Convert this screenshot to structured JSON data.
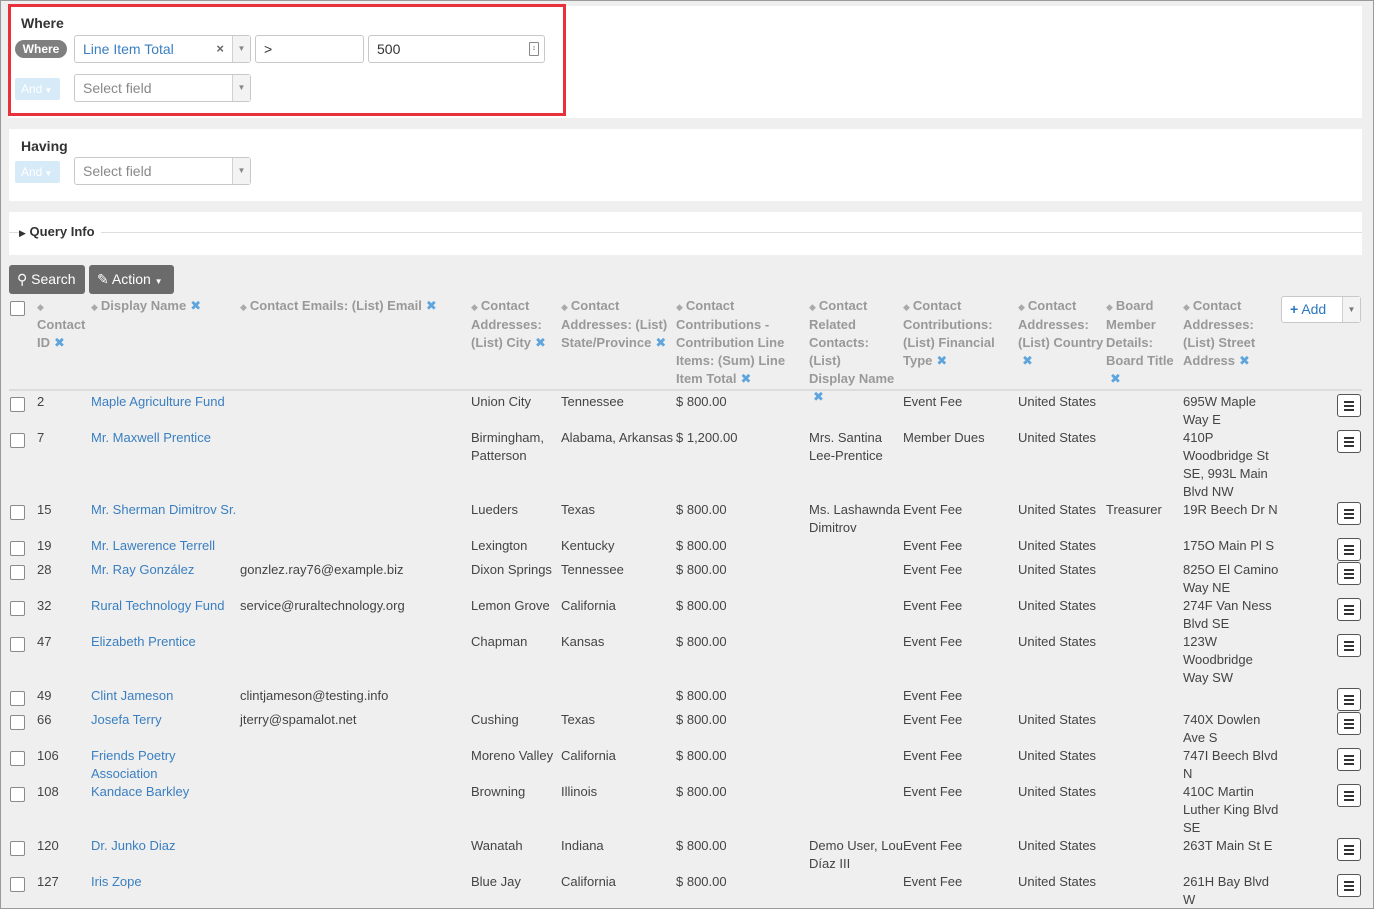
{
  "where": {
    "title": "Where",
    "pill": "Where",
    "field": "Line Item Total",
    "clear": "×",
    "operator": ">",
    "value": "500",
    "and_label": "And",
    "select_placeholder": "Select field"
  },
  "having": {
    "title": "Having",
    "and_label": "And",
    "select_placeholder": "Select field"
  },
  "query_info": {
    "label": "Query Info"
  },
  "toolbar": {
    "search_label": "Search",
    "action_label": "Action",
    "add_label": "Add"
  },
  "columns": [
    {
      "lines": [
        "",
        "Contact",
        "ID"
      ]
    },
    {
      "lines": [
        "Display Name"
      ]
    },
    {
      "lines": [
        "Contact Emails: (List) Email"
      ]
    },
    {
      "lines": [
        "Contact",
        "Addresses:",
        "(List) City"
      ]
    },
    {
      "lines": [
        "Contact",
        "Addresses: (List)",
        "State/Province"
      ]
    },
    {
      "lines": [
        "Contact",
        "Contributions -",
        "Contribution Line",
        "Items: (Sum) Line",
        "Item Total"
      ]
    },
    {
      "lines": [
        "Contact",
        "Related",
        "Contacts: (List)",
        "Display Name",
        ""
      ]
    },
    {
      "lines": [
        "Contact",
        "Contributions:",
        "(List) Financial",
        "Type"
      ]
    },
    {
      "lines": [
        "Contact",
        "Addresses:",
        "(List) Country",
        ""
      ]
    },
    {
      "lines": [
        "Board",
        "Member",
        "Details:",
        "Board Title",
        ""
      ]
    },
    {
      "lines": [
        "Contact",
        "Addresses:",
        "(List) Street",
        "Address"
      ]
    }
  ],
  "rows": [
    {
      "id": "2",
      "name": [
        "Maple Agriculture Fund"
      ],
      "email": "",
      "city": [
        "Union City"
      ],
      "state": [
        "Tennessee"
      ],
      "total": "$ 800.00",
      "related": [],
      "type": "Event Fee",
      "country": "United States",
      "board": "",
      "street": [
        "695W Maple",
        "Way E"
      ]
    },
    {
      "id": "7",
      "name": [
        "Mr. Maxwell Prentice"
      ],
      "email": "",
      "city": [
        "Birmingham,",
        "Patterson"
      ],
      "state": [
        "Alabama, Arkansas"
      ],
      "total": "$ 1,200.00",
      "related": [
        "Mrs. Santina",
        "Lee-Prentice"
      ],
      "type": "Member Dues",
      "country": "United States",
      "board": "",
      "street": [
        "410P",
        "Woodbridge St",
        "SE, 993L Main",
        "Blvd NW"
      ]
    },
    {
      "id": "15",
      "name": [
        "Mr. Sherman Dimitrov Sr."
      ],
      "email": "",
      "city": [
        "Lueders"
      ],
      "state": [
        "Texas"
      ],
      "total": "$ 800.00",
      "related": [
        "Ms. Lashawnda",
        "Dimitrov"
      ],
      "type": "Event Fee",
      "country": "United States",
      "board": "Treasurer",
      "street": [
        "19R Beech Dr N"
      ]
    },
    {
      "id": "19",
      "name": [
        "Mr. Lawerence Terrell"
      ],
      "email": "",
      "city": [
        "Lexington"
      ],
      "state": [
        "Kentucky"
      ],
      "total": "$ 800.00",
      "related": [],
      "type": "Event Fee",
      "country": "United States",
      "board": "",
      "street": [
        "175O Main Pl S"
      ]
    },
    {
      "id": "28",
      "name": [
        "Mr. Ray González"
      ],
      "email": "gonzlez.ray76@example.biz",
      "city": [
        "Dixon Springs"
      ],
      "state": [
        "Tennessee"
      ],
      "total": "$ 800.00",
      "related": [],
      "type": "Event Fee",
      "country": "United States",
      "board": "",
      "street": [
        "825O El Camino",
        "Way NE"
      ]
    },
    {
      "id": "32",
      "name": [
        "Rural Technology Fund"
      ],
      "email": "service@ruraltechnology.org",
      "city": [
        "Lemon Grove"
      ],
      "state": [
        "California"
      ],
      "total": "$ 800.00",
      "related": [],
      "type": "Event Fee",
      "country": "United States",
      "board": "",
      "street": [
        "274F Van Ness",
        "Blvd SE"
      ]
    },
    {
      "id": "47",
      "name": [
        "Elizabeth Prentice"
      ],
      "email": "",
      "city": [
        "Chapman"
      ],
      "state": [
        "Kansas"
      ],
      "total": "$ 800.00",
      "related": [],
      "type": "Event Fee",
      "country": "United States",
      "board": "",
      "street": [
        "123W",
        "Woodbridge",
        "Way SW"
      ]
    },
    {
      "id": "49",
      "name": [
        "Clint Jameson"
      ],
      "email": "clintjameson@testing.info",
      "city": [],
      "state": [],
      "total": "$ 800.00",
      "related": [],
      "type": "Event Fee",
      "country": "",
      "board": "",
      "street": []
    },
    {
      "id": "66",
      "name": [
        "Josefa Terry"
      ],
      "email": "jterry@spamalot.net",
      "city": [
        "Cushing"
      ],
      "state": [
        "Texas"
      ],
      "total": "$ 800.00",
      "related": [],
      "type": "Event Fee",
      "country": "United States",
      "board": "",
      "street": [
        "740X Dowlen",
        "Ave S"
      ]
    },
    {
      "id": "106",
      "name": [
        "Friends Poetry",
        "Association"
      ],
      "email": "",
      "city": [
        "Moreno Valley"
      ],
      "state": [
        "California"
      ],
      "total": "$ 800.00",
      "related": [],
      "type": "Event Fee",
      "country": "United States",
      "board": "",
      "street": [
        "747I Beech Blvd",
        "N"
      ]
    },
    {
      "id": "108",
      "name": [
        "Kandace Barkley"
      ],
      "email": "",
      "city": [
        "Browning"
      ],
      "state": [
        "Illinois"
      ],
      "total": "$ 800.00",
      "related": [],
      "type": "Event Fee",
      "country": "United States",
      "board": "",
      "street": [
        "410C Martin",
        "Luther King Blvd",
        "SE"
      ]
    },
    {
      "id": "120",
      "name": [
        "Dr. Junko Diaz"
      ],
      "email": "",
      "city": [
        "Wanatah"
      ],
      "state": [
        "Indiana"
      ],
      "total": "$ 800.00",
      "related": [
        "Demo User, Lou",
        "Díaz III"
      ],
      "type": "Event Fee",
      "country": "United States",
      "board": "",
      "street": [
        "263T Main St E"
      ]
    },
    {
      "id": "127",
      "name": [
        "Iris Zope"
      ],
      "email": "",
      "city": [
        "Blue Jay"
      ],
      "state": [
        "California"
      ],
      "total": "$ 800.00",
      "related": [],
      "type": "Event Fee",
      "country": "United States",
      "board": "",
      "street": [
        "261H Bay Blvd",
        "W"
      ]
    }
  ]
}
